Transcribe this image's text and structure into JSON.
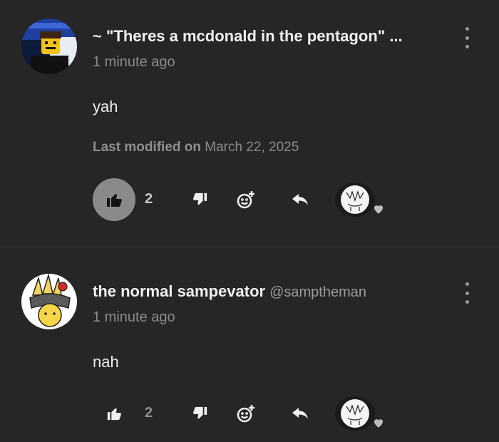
{
  "comments": [
    {
      "author": "~ \"Theres a mcdonald in the pentagon\" ...",
      "handle": "",
      "time": "1 minute ago",
      "text": "yah",
      "modified_prefix": "Last modified on",
      "modified_date": "March 22, 2025",
      "likes": "2",
      "liked": true,
      "avatar_icon": "blocky-avatar-icon"
    },
    {
      "author": "the normal sampevator",
      "handle": "@samptheman",
      "time": "1 minute ago",
      "text": "nah",
      "likes": "2",
      "liked": false,
      "avatar_icon": "chef-avatar-icon"
    }
  ],
  "colors": {
    "background": "#262626",
    "liked_bg": "#8a8a8a",
    "text_primary": "#f0f0f0",
    "text_secondary": "#8a8a8a"
  }
}
